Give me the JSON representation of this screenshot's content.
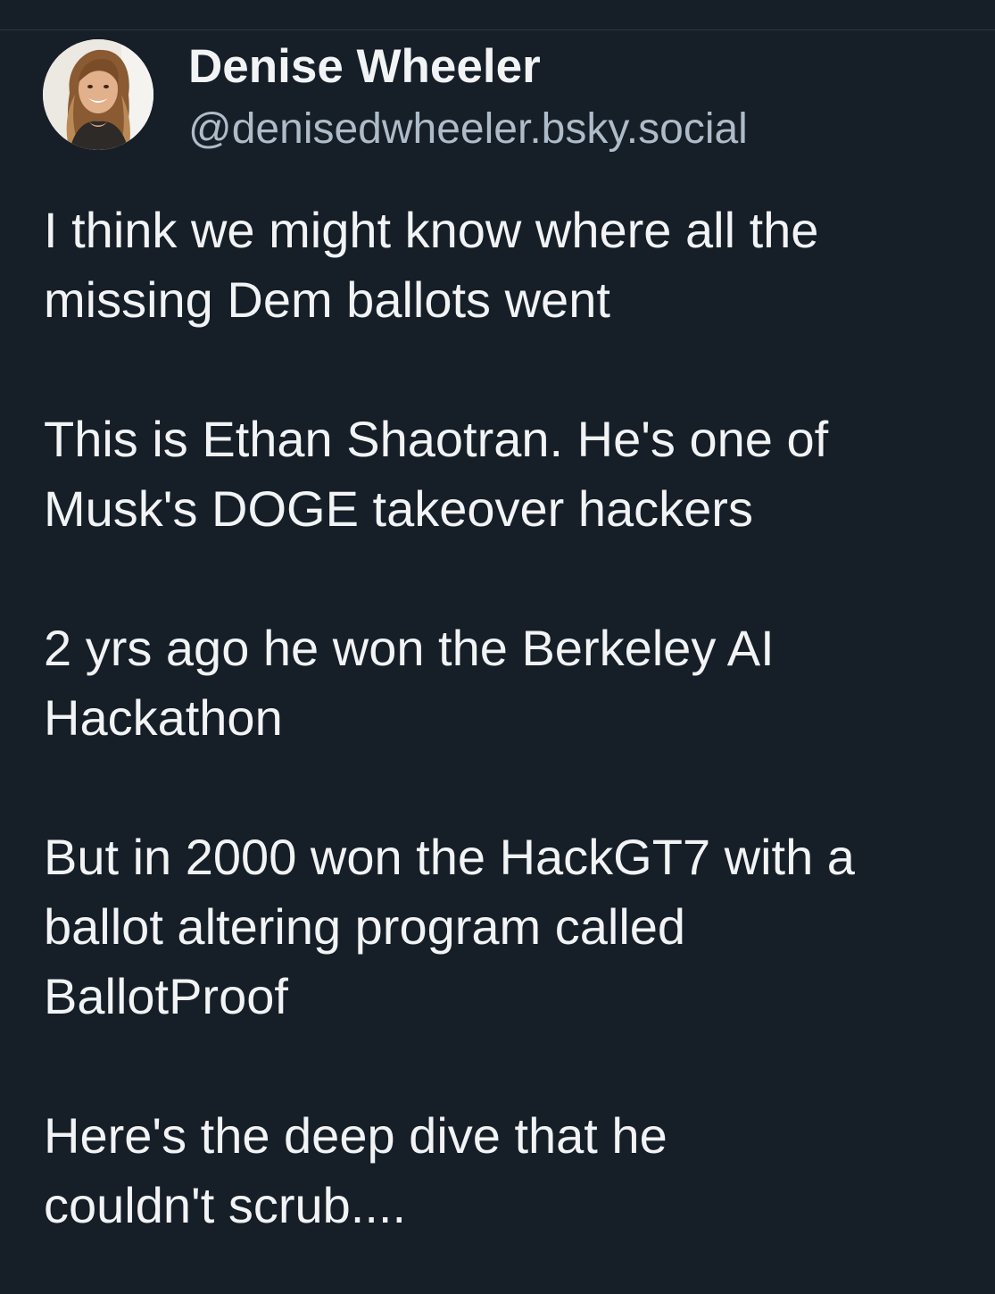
{
  "post": {
    "author": {
      "display_name": "Denise Wheeler",
      "handle": "@denisedwheeler.bsky.social",
      "avatar_icon": "profile-photo"
    },
    "paragraphs": [
      "I think we might know where all the\nmissing Dem ballots went",
      "This is Ethan Shaotran. He's one of\nMusk's DOGE takeover hackers",
      "2 yrs ago he won the Berkeley AI\nHackathon",
      "But in 2000 won the HackGT7 with a\nballot altering program called\nBallotProof",
      "Here's the deep dive that he\ncouldn't scrub...."
    ]
  },
  "colors": {
    "background": "#161e27",
    "primary_text": "#f1f3f5",
    "secondary_text": "#aebbc9",
    "divider": "#2b3642"
  }
}
